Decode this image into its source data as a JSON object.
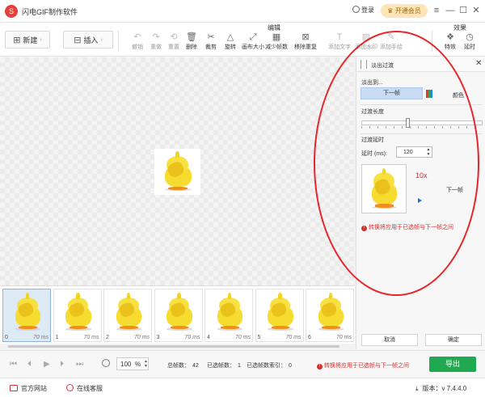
{
  "app": {
    "title": "闪电GIF制作软件",
    "login": "登录",
    "vip": "开通会员",
    "logo_glyph": "S"
  },
  "toolbar": {
    "group_edit": "编辑",
    "group_effects": "效果",
    "new_label": "新建",
    "insert_label": "插入",
    "tools": [
      {
        "label": "撤销",
        "icon": "undo-icon",
        "glyph": "↶",
        "enabled": false
      },
      {
        "label": "重做",
        "icon": "redo-icon",
        "glyph": "↷",
        "enabled": false
      },
      {
        "label": "重置",
        "icon": "reset-icon",
        "glyph": "⟲",
        "enabled": false
      },
      {
        "label": "删除",
        "icon": "trash-icon",
        "glyph": "🗑",
        "enabled": true
      },
      {
        "label": "裁剪",
        "icon": "scissors-icon",
        "glyph": "✂",
        "enabled": true
      },
      {
        "label": "旋转",
        "icon": "rotate-icon",
        "glyph": "△",
        "enabled": true
      },
      {
        "label": "画布大小",
        "icon": "canvas-size-icon",
        "glyph": "⤢",
        "enabled": true
      },
      {
        "label": "减少帧数",
        "icon": "reduce-frames-icon",
        "glyph": "▦",
        "enabled": true
      },
      {
        "label": "移除重复",
        "icon": "remove-duplicate-icon",
        "glyph": "⊠",
        "enabled": true
      },
      {
        "label": "添加文字",
        "icon": "add-text-icon",
        "glyph": "T",
        "enabled": false
      },
      {
        "label": "添加水印",
        "icon": "add-watermark-icon",
        "glyph": "▨",
        "enabled": false
      },
      {
        "label": "添加手绘",
        "icon": "add-drawing-icon",
        "glyph": "✎",
        "enabled": false
      },
      {
        "label": "特效",
        "icon": "effects-icon",
        "glyph": "❖",
        "enabled": true
      },
      {
        "label": "延时",
        "icon": "delay-icon",
        "glyph": "◷",
        "enabled": true
      }
    ]
  },
  "panel": {
    "title": "淡出过渡",
    "fade_to_label": "淡出到...",
    "next_frame_option": "下一帧",
    "color_option": "颜色",
    "transition_length_label": "过渡长度",
    "transition_length_value": 0.38,
    "transition_delay_label": "过渡延时",
    "delay_label": "延时 (ms):",
    "delay_value": "120",
    "multiplier": "10x",
    "next_frame_label": "下一帧",
    "warning": "转换将应用于已选帧与下一帧之间",
    "cancel": "取消",
    "confirm": "确定"
  },
  "frames": [
    {
      "index": "0",
      "ms": "70 ms",
      "selected": true
    },
    {
      "index": "1",
      "ms": "70 ms",
      "selected": false
    },
    {
      "index": "2",
      "ms": "70 ms",
      "selected": false
    },
    {
      "index": "3",
      "ms": "70 ms",
      "selected": false
    },
    {
      "index": "4",
      "ms": "70 ms",
      "selected": false
    },
    {
      "index": "5",
      "ms": "70 ms",
      "selected": false
    },
    {
      "index": "6",
      "ms": "70 ms",
      "selected": false
    }
  ],
  "playback": {
    "zoom": "100",
    "zoom_unit": "%",
    "total_label": "总帧数：",
    "total": "42",
    "selected_label": "已选帧数：",
    "selected": "1",
    "selected_index_label": "已选帧数索引：",
    "selected_index": "0",
    "warning": "转换将应用于已选帧与下一帧之间",
    "export": "导出"
  },
  "status": {
    "website": "官方网站",
    "support": "在线客服",
    "version": "版本：v 7.4.4.0"
  },
  "colors": {
    "accent_red": "#e6262a",
    "export_green": "#21a952",
    "selection_blue": "#c9dcf4"
  }
}
